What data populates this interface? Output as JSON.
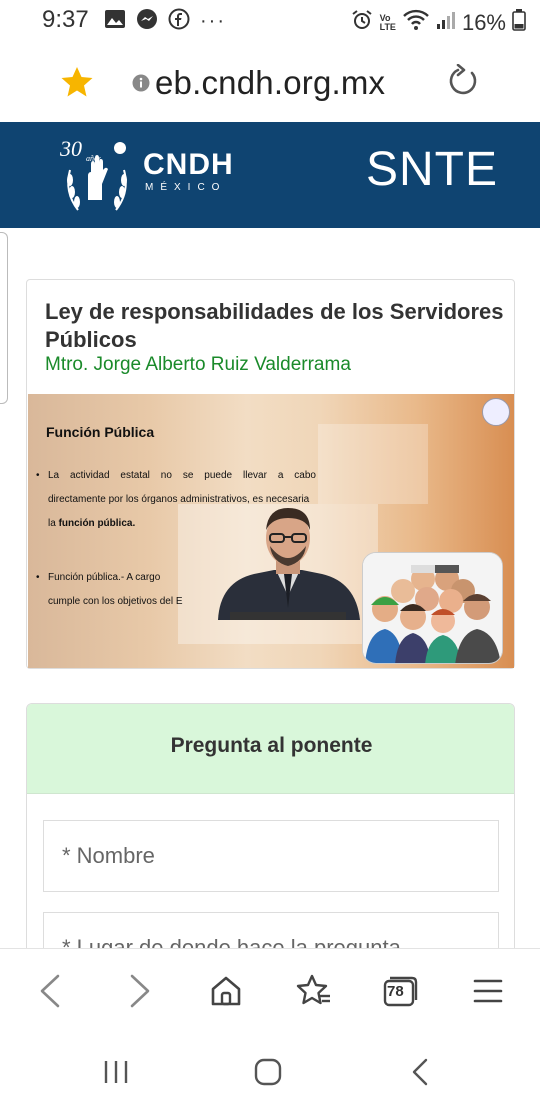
{
  "status_bar": {
    "time": "9:37",
    "battery": "16%",
    "network_label_top": "Vo",
    "network_label_bottom": "LTE"
  },
  "browser": {
    "url": "eb.cndh.org.mx",
    "tab_count": "78"
  },
  "site_header": {
    "logo_anniversary": "30",
    "logo_anos": "años",
    "logo_name": "CNDH",
    "logo_country": "MÉXICO",
    "title": "SNTE"
  },
  "card": {
    "title": "Ley de responsabilidades de los Servidores Públicos",
    "speaker": "Mtro. Jorge Alberto Ruiz Valderrama",
    "slide": {
      "title": "Función Pública",
      "bullet1_line1": "La actividad estatal no se puede llevar a cabo",
      "bullet1_line2": "directamente por los órganos administrativos, es necesaria",
      "bullet1_line3_prefix": "la ",
      "bullet1_line3_bold": "función pública.",
      "bullet2_line1": "Función pública.- A cargo",
      "bullet2_line2": "cumple con los objetivos del E"
    }
  },
  "question_form": {
    "title": "Pregunta al ponente",
    "name_placeholder": "* Nombre",
    "place_placeholder": "* Lugar de donde hace la pregunta"
  },
  "colors": {
    "header_bg": "#0f4471",
    "speaker_green": "#1a8a2a",
    "question_header_bg": "#d9f7da",
    "star_yellow": "#f7b500"
  }
}
